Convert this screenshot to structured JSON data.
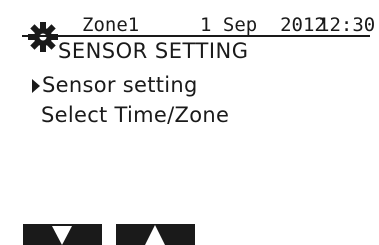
{
  "header": {
    "zone": "Zone1",
    "date": "1 Sep  2012",
    "time": "12:30",
    "icon": "gear-icon"
  },
  "title": "SENSOR SETTING",
  "menu": {
    "items": [
      {
        "label": "Sensor setting",
        "selected": true
      },
      {
        "label": "Select Time/Zone",
        "selected": false
      }
    ]
  },
  "softkeys": [
    {
      "icon": "down-arrow-icon"
    },
    {
      "icon": "up-arrow-icon"
    }
  ],
  "colors": {
    "foreground": "#1a1a1a",
    "background": "#ffffff"
  }
}
